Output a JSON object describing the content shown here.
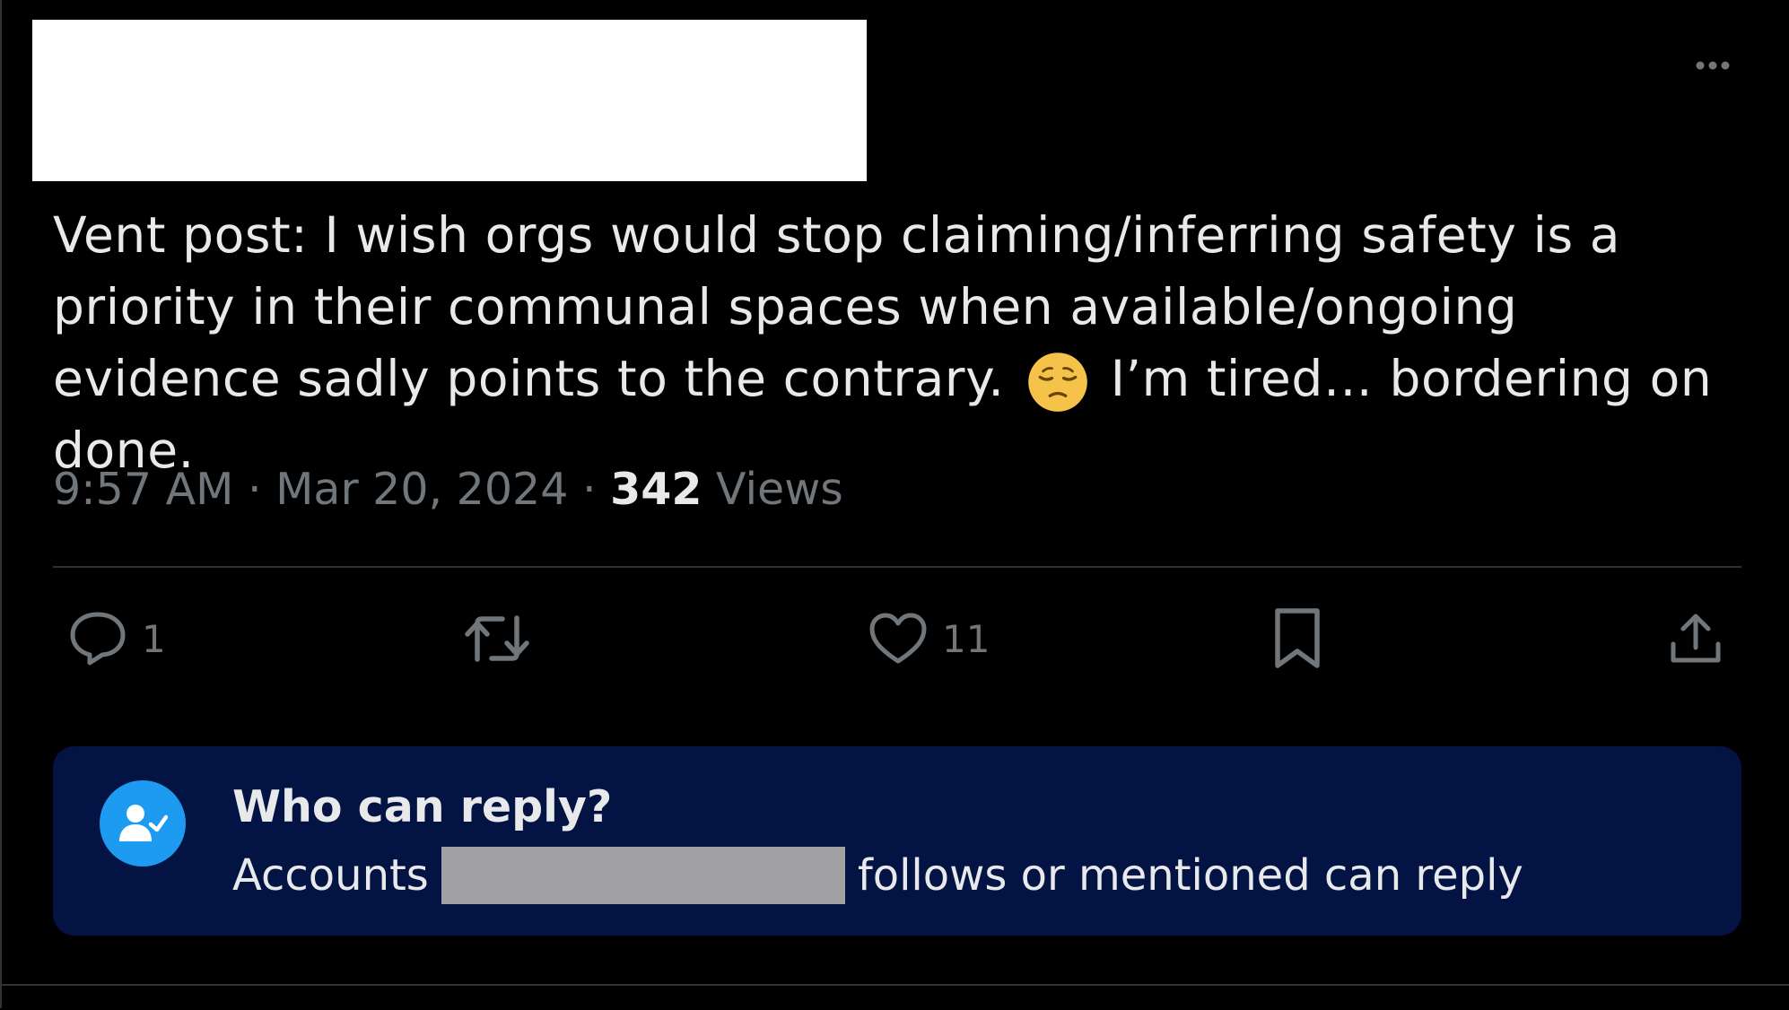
{
  "post": {
    "text_before_emoji": "Vent post: I wish orgs would stop claiming/inferring safety is a priority in their communal spaces when available/ongoing evidence sadly points to the contrary.",
    "emoji": "pensive-face",
    "text_after_emoji": "I’m tired… bordering on done."
  },
  "meta": {
    "time": "9:57 AM",
    "separator": "·",
    "date": "Mar 20, 2024",
    "views_count": "342",
    "views_label": "Views"
  },
  "actions": {
    "reply_count": "1",
    "like_count": "11"
  },
  "reply_settings": {
    "title": "Who can reply?",
    "desc_prefix": "Accounts",
    "desc_suffix": "follows or mentioned can reply"
  },
  "colors": {
    "background": "#000000",
    "text_primary": "#e7e9ea",
    "text_secondary": "#71767b",
    "reply_box_bg": "#031343",
    "accent_blue": "#1d9bf0",
    "redaction_white": "#ffffff",
    "redaction_gray": "#a1a1a4"
  },
  "icons": [
    "more-icon",
    "reply-icon",
    "retweet-icon",
    "like-icon",
    "bookmark-icon",
    "share-icon",
    "user-check-icon"
  ]
}
